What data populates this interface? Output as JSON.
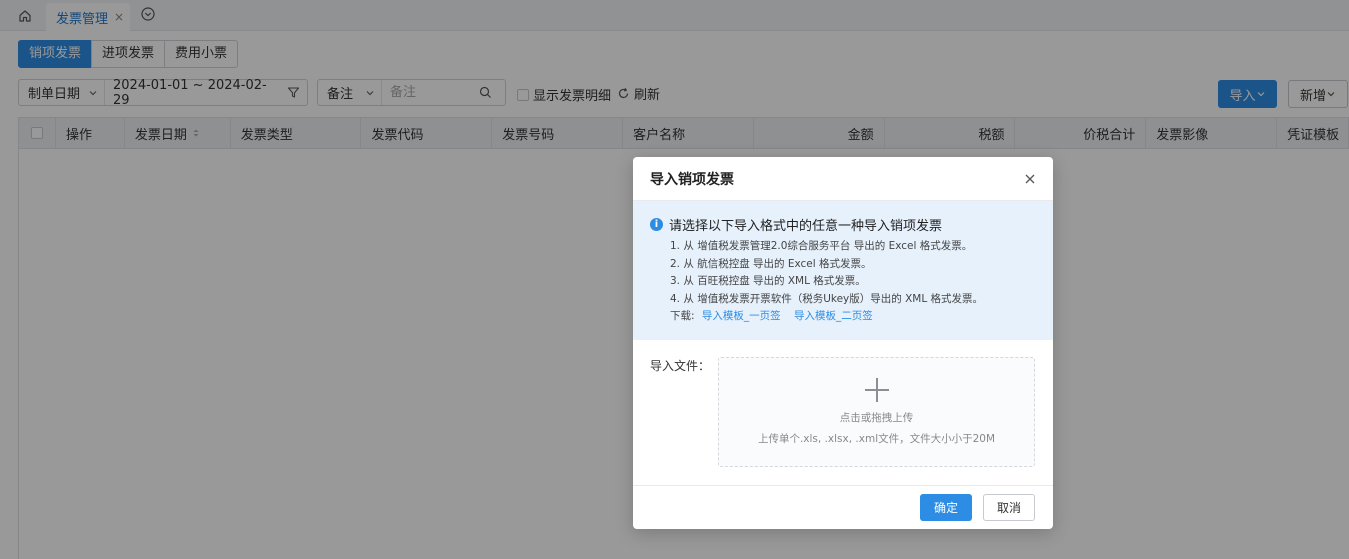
{
  "tabbar": {
    "page_tab_label": "发票管理",
    "page_tab_close": "×"
  },
  "invoice_tabs": [
    "销项发票",
    "进项发票",
    "费用小票"
  ],
  "filters": {
    "date_field": "制单日期",
    "date_range": "2024-01-01 ~ 2024-02-29",
    "note_field": "备注",
    "note_placeholder": "备注",
    "show_detail_label": "显示发票明细",
    "refresh_label": "刷新"
  },
  "toolbar": {
    "import_label": "导入",
    "new_label": "新增"
  },
  "table": {
    "columns": [
      "操作",
      "发票日期",
      "发票类型",
      "发票代码",
      "发票号码",
      "客户名称",
      "金额",
      "税额",
      "价税合计",
      "发票影像",
      "凭证模板"
    ]
  },
  "modal": {
    "title": "导入销项发票",
    "info_title": "请选择以下导入格式中的任意一种导入销项发票",
    "info_items": [
      "1.  从 增值税发票管理2.0综合服务平台 导出的 Excel 格式发票。",
      "2.  从 航信税控盘 导出的 Excel 格式发票。",
      "3.  从 百旺税控盘 导出的 XML 格式发票。",
      "4.  从 增值税发票开票软件（税务Ukey版）导出的 XML 格式发票。"
    ],
    "download_label": "下载:",
    "download_links": [
      "导入模板_一页签",
      "导入模板_二页签"
    ],
    "upload_label": "导入文件：",
    "upload_hint": "点击或拖拽上传",
    "upload_note": "上传单个.xls, .xlsx, .xml文件，文件大小小于20M",
    "ok_label": "确定",
    "cancel_label": "取消"
  },
  "colors": {
    "primary": "#2d8ce3",
    "info_bg": "#e6f1fc",
    "mask": "rgba(0,0,0,0.40)"
  }
}
